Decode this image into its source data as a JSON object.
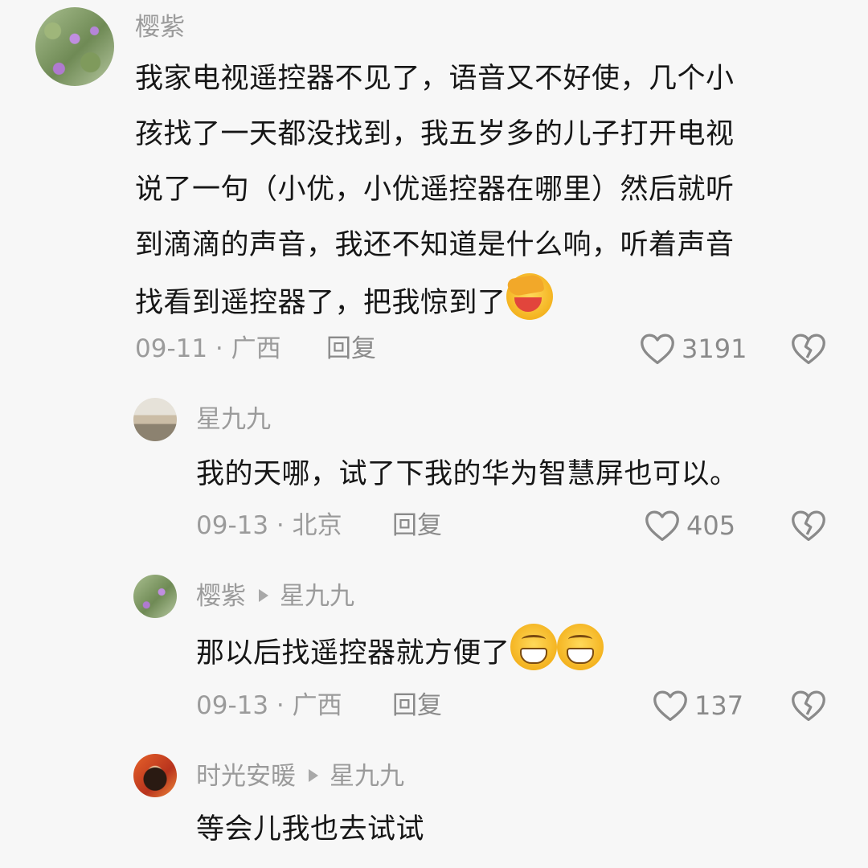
{
  "comments": [
    {
      "author": "樱紫",
      "text": [
        "我家电视遥控器不见了，语音又不好使，几个小",
        "孩找了一天都没找到，我五岁多的儿子打开电视",
        "说了一句（小优，小优遥控器在哪里）然后就听",
        "到滴滴的声音，我还不知道是什么响，听着声音",
        "找看到遥控器了，把我惊到了"
      ],
      "meta": "09-11 · 广西",
      "reply_label": "回复",
      "likes": "3191"
    },
    {
      "author": "星九九",
      "text": "我的天哪，试了下我的华为智慧屏也可以。",
      "meta": "09-13 · 北京",
      "reply_label": "回复",
      "likes": "405"
    },
    {
      "author": "樱紫",
      "reply_to": "星九九",
      "text": "那以后找遥控器就方便了",
      "meta": "09-13 · 广西",
      "reply_label": "回复",
      "likes": "137"
    },
    {
      "author": "时光安暖",
      "reply_to": "星九九",
      "text": "等会儿我也去试试"
    }
  ],
  "icons": {
    "like": "heart-outline-icon",
    "dislike": "broken-heart-icon"
  },
  "colors": {
    "background": "#f7f7f7",
    "text": "#161616",
    "muted": "#9b9b9b"
  }
}
